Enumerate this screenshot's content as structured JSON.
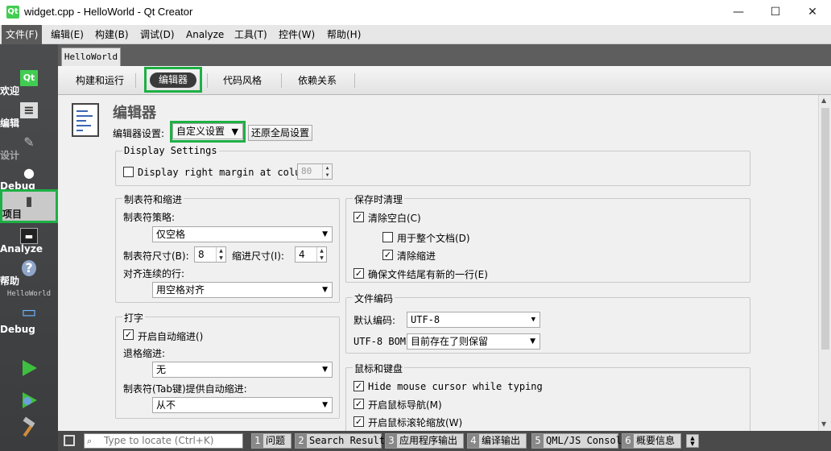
{
  "window": {
    "title": "widget.cpp - HelloWorld - Qt Creator",
    "app_icon": "Qt",
    "minimize": "—",
    "maximize": "☐",
    "close": "✕"
  },
  "menubar": [
    "文件(F)",
    "编辑(E)",
    "构建(B)",
    "调试(D)",
    "Analyze",
    "工具(T)",
    "控件(W)",
    "帮助(H)"
  ],
  "modes": {
    "welcome": "欢迎",
    "edit": "编辑",
    "design": "设计",
    "debug": "Debug",
    "projects": "项目",
    "analyze": "Analyze",
    "help": "帮助",
    "kit_project": "HelloWorld",
    "kit_build": "Debug"
  },
  "doc_tab": "HelloWorld",
  "tabs": [
    "构建和运行",
    "编辑器",
    "代码风格",
    "依赖关系"
  ],
  "editor": {
    "heading": "编辑器",
    "settings_label": "编辑器设置:",
    "settings_value": "自定义设置",
    "restore_button": "还原全局设置"
  },
  "display": {
    "title": "Display Settings",
    "margin_label": "Display right margin at column:",
    "margin_value": "80",
    "margin_checked": false
  },
  "tabs_indent": {
    "title": "制表符和缩进",
    "policy_label": "制表符策略:",
    "policy_value": "仅空格",
    "tab_size_label": "制表符尺寸(B):",
    "tab_size": "8",
    "indent_size_label": "缩进尺寸(I):",
    "indent_size": "4",
    "align_label": "对齐连续的行:",
    "align_value": "用空格对齐"
  },
  "typing": {
    "title": "打字",
    "auto_indent": "开启自动缩进()",
    "backspace_label": "退格缩进:",
    "backspace_value": "无",
    "tab_indent_label": "制表符(Tab键)提供自动缩进:",
    "tab_indent_value": "从不"
  },
  "cleanup": {
    "title": "保存时清理",
    "clean_whitespace": "清除空白(C)",
    "entire_doc": "用于整个文档(D)",
    "clean_indent": "清除缩进",
    "newline": "确保文件结尾有新的一行(E)"
  },
  "encoding": {
    "title": "文件编码",
    "default_label": "默认编码:",
    "default_value": "UTF-8",
    "bom_label": "UTF-8 BOM:",
    "bom_value": "目前存在了则保留"
  },
  "mouse": {
    "title": "鼠标和键盘",
    "hide_cursor": "Hide mouse cursor while typing",
    "nav": "开启鼠标导航(M)",
    "wheel_zoom": "开启鼠标滚轮缩放(W)"
  },
  "statusbar": {
    "locate_placeholder": "Type to locate (Ctrl+K)",
    "panes": [
      {
        "num": "1",
        "label": "问题"
      },
      {
        "num": "2",
        "label": "Search Results"
      },
      {
        "num": "3",
        "label": "应用程序输出"
      },
      {
        "num": "4",
        "label": "编译输出"
      },
      {
        "num": "5",
        "label": "QML/JS Console"
      },
      {
        "num": "6",
        "label": "概要信息"
      }
    ]
  },
  "colors": {
    "highlight": "#1db045",
    "modebar": "#404244",
    "run": "#3fbf3f"
  }
}
